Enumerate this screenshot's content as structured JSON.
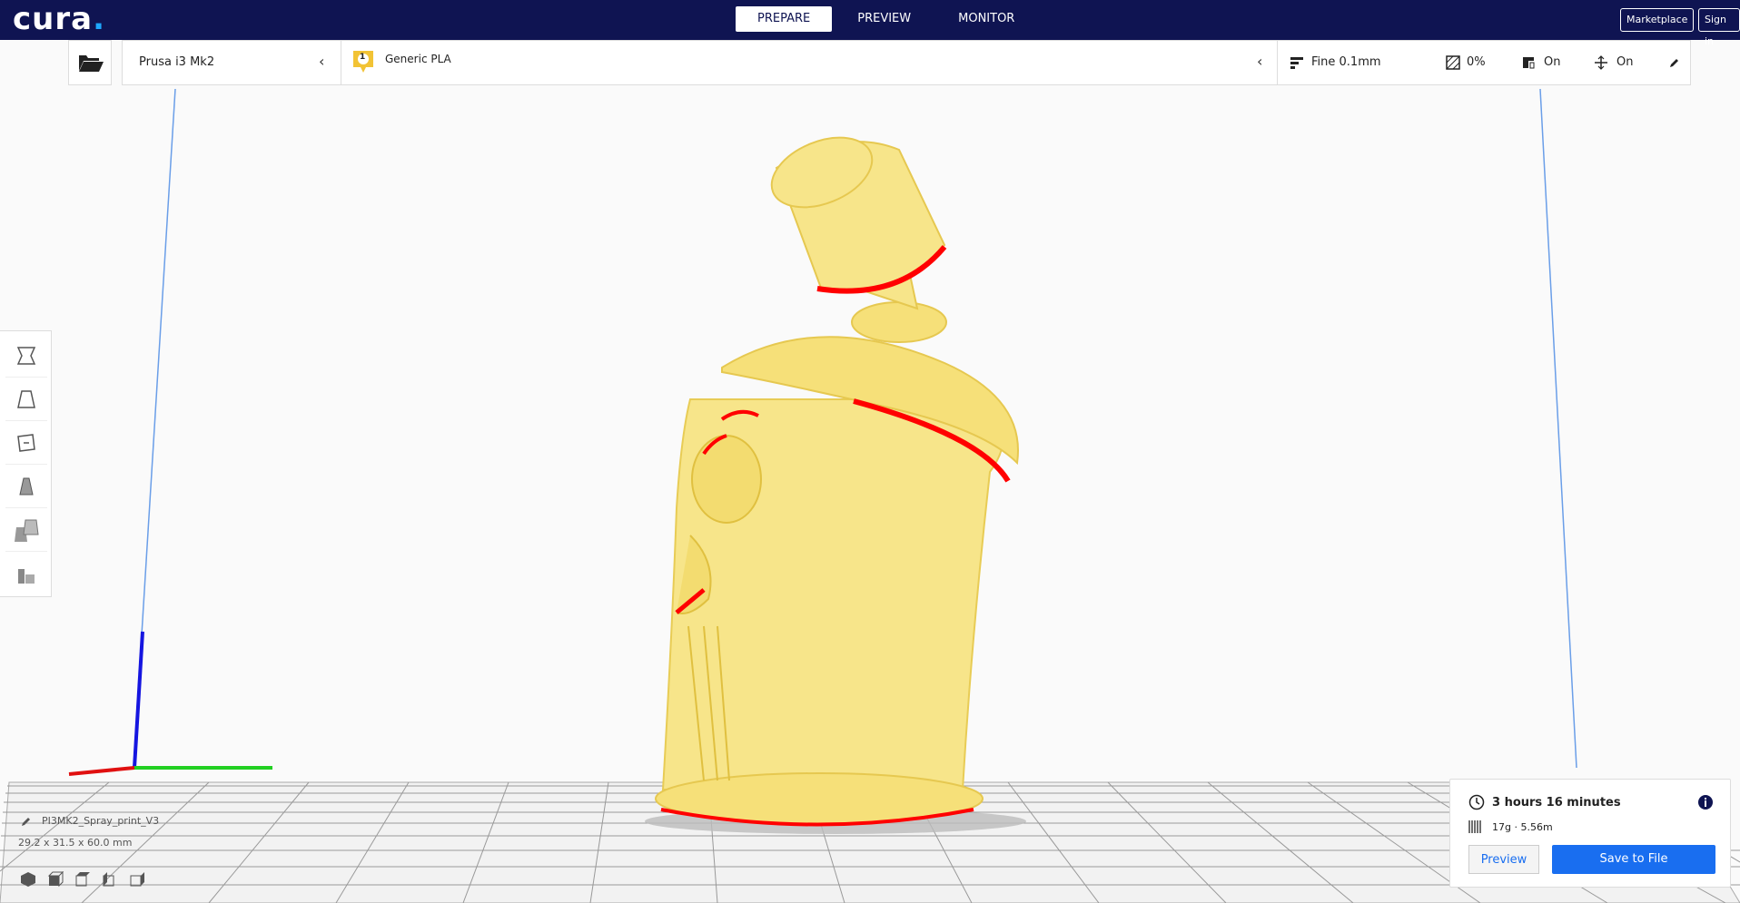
{
  "app": {
    "logo_text": "cura",
    "logo_dot": "."
  },
  "stages": [
    {
      "label": "PREPARE",
      "active": true
    },
    {
      "label": "PREVIEW",
      "active": false
    },
    {
      "label": "MONITOR",
      "active": false
    }
  ],
  "header": {
    "marketplace_label": "Marketplace",
    "signin_label": "Sign in"
  },
  "printer": {
    "name": "Prusa i3 Mk2"
  },
  "material": {
    "extruder_number": "1",
    "name": "Generic PLA"
  },
  "settings": {
    "profile": "Fine 0.1mm",
    "infill": "0%",
    "support": "On",
    "adhesion": "On"
  },
  "object": {
    "name": "PI3MK2_Spray_print_V3",
    "dimensions": "29.2 x 31.5 x 60.0 mm"
  },
  "print_info": {
    "time": "3 hours 16 minutes",
    "material_usage": "17g · 5.56m",
    "preview_label": "Preview",
    "save_label": "Save to File"
  },
  "colors": {
    "header_bg": "#0f1452",
    "accent": "#196ef0",
    "model_fill": "#f7e58a",
    "overhang": "#ff0000",
    "material_badge": "#f2c335"
  }
}
